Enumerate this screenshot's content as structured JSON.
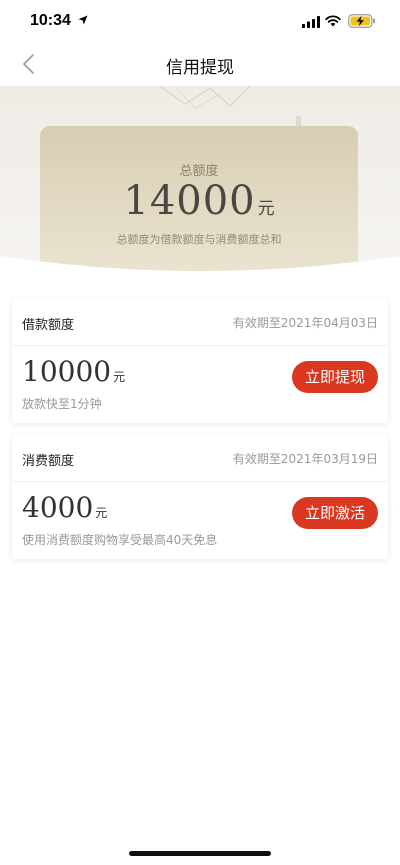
{
  "status_bar": {
    "time": "10:34"
  },
  "nav": {
    "title": "信用提现"
  },
  "total": {
    "label": "总额度",
    "amount": "14000",
    "unit": "元",
    "description": "总额度为借款额度与消费额度总和"
  },
  "cards": [
    {
      "title": "借款额度",
      "validity": "有效期至2021年04月03日",
      "amount": "10000",
      "unit": "元",
      "note": "放款快至1分钟",
      "button_label": "立即提现"
    },
    {
      "title": "消费额度",
      "validity": "有效期至2021年03月19日",
      "amount": "4000",
      "unit": "元",
      "note": "使用消费额度购物享受最高40天免息",
      "button_label": "立即激活"
    }
  ],
  "colors": {
    "accent_red": "#d9371f",
    "card_gold": "#e3dbc5"
  },
  "icons": {
    "back": "chevron-left-icon",
    "location": "location-arrow-icon",
    "signal": "cellular-signal-icon",
    "wifi": "wifi-icon",
    "battery": "battery-charging-icon"
  }
}
